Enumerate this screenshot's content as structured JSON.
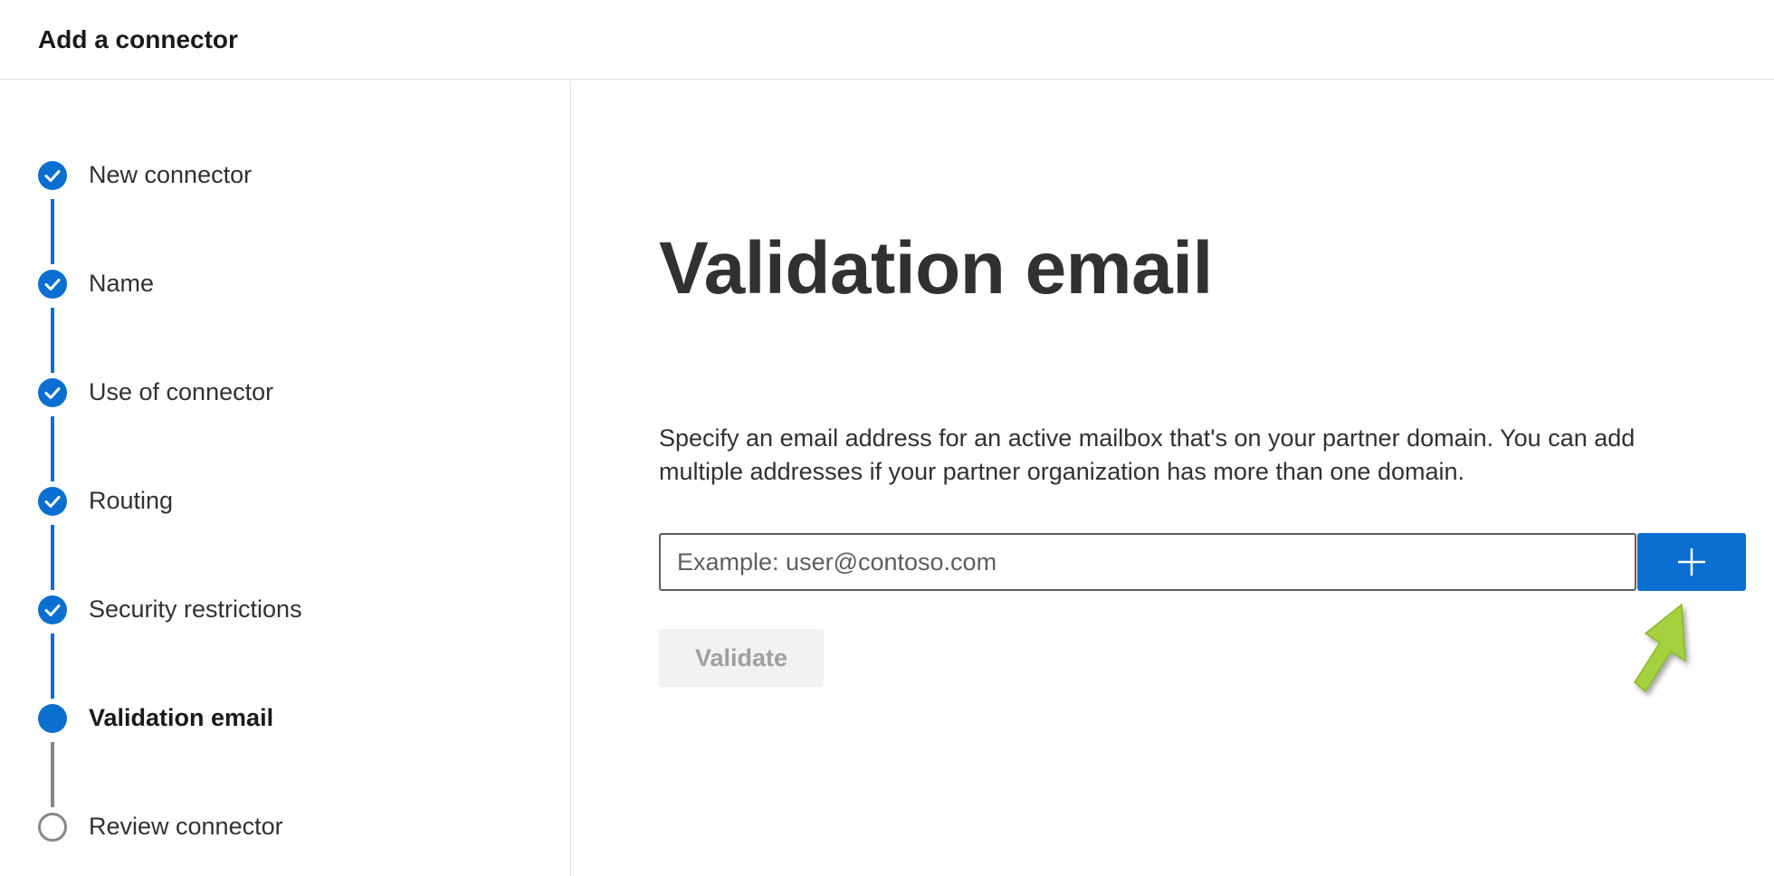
{
  "header": {
    "title": "Add a connector"
  },
  "steps": [
    {
      "label": "New connector",
      "status": "done"
    },
    {
      "label": "Name",
      "status": "done"
    },
    {
      "label": "Use of connector",
      "status": "done"
    },
    {
      "label": "Routing",
      "status": "done"
    },
    {
      "label": "Security restrictions",
      "status": "done"
    },
    {
      "label": "Validation email",
      "status": "current"
    },
    {
      "label": "Review connector",
      "status": "pending"
    }
  ],
  "main": {
    "title": "Validation email",
    "description": "Specify an email address for an active mailbox that's on your partner domain. You can add multiple addresses if your partner organization has more than one domain.",
    "email_input": {
      "value": "",
      "placeholder": "Example: user@contoso.com"
    },
    "add_button_icon": "plus-icon",
    "validate_label": "Validate"
  },
  "colors": {
    "accent": "#0a6fd0",
    "annotation_arrow": "#a4d13c",
    "disabled_bg": "#f3f2f1",
    "disabled_text": "#a19f9d"
  }
}
